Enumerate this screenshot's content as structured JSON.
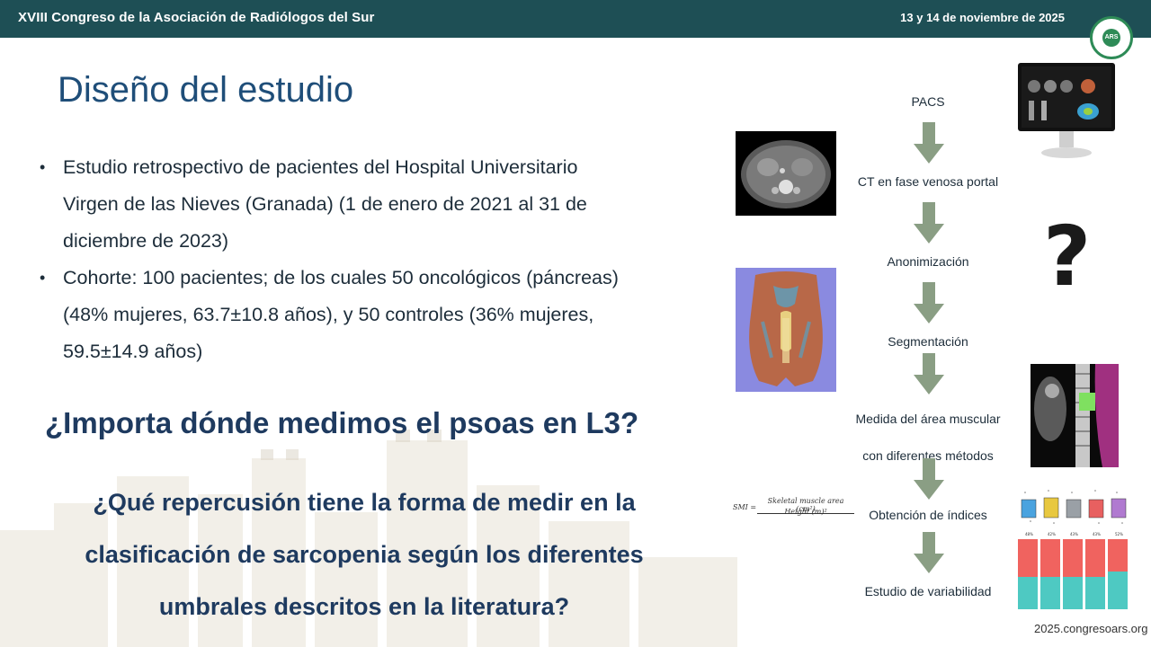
{
  "header": {
    "congress": "XVIII Congreso de la Asociación de Radiólogos del Sur",
    "dates": "13 y 14 de noviembre de 2025",
    "logo_text": "ARS"
  },
  "title": "Diseño del estudio",
  "bullets": [
    {
      "marker": "•",
      "lines": [
        "Estudio retrospectivo de pacientes del Hospital Universitario",
        "Virgen de las Nieves (Granada) (1 de enero de 2021 al 31 de",
        "diciembre de 2023)"
      ]
    },
    {
      "marker": "•",
      "lines": [
        "Cohorte: 100 pacientes; de los cuales 50 oncológicos (páncreas)",
        "(48% mujeres, 63.7±10.8 años), y 50 controles (36% mujeres,",
        "59.5±14.9 años)"
      ]
    }
  ],
  "question_1": "¿Importa dónde medimos el psoas en L3?",
  "question_2": [
    "¿Qué repercusión tiene la forma de medir en la",
    "clasificación de sarcopenia según los diferentes",
    "umbrales descritos en la literatura?"
  ],
  "flow": {
    "steps": [
      {
        "label": "PACS"
      },
      {
        "label": "CT en fase venosa portal"
      },
      {
        "label": "Anonimización"
      },
      {
        "label": "Segmentación"
      },
      {
        "label_lines": [
          "Medida del área muscular",
          "con diferentes métodos"
        ]
      },
      {
        "label": "Obtención de índices"
      },
      {
        "label": "Estudio de variabilidad"
      }
    ],
    "arrow_color": "#8a9e84"
  },
  "formula": {
    "lhs": "SMI =",
    "numerator": "Skeletal muscle area (cm²)",
    "denominator": "Height (m)²"
  },
  "chart_percent_labels": [
    "48%",
    "42%",
    "43%",
    "43%",
    "52%"
  ],
  "question_mark": "?",
  "footer_url": "2025.congresoars.org",
  "colors": {
    "header_bg": "#1e4f55",
    "title": "#1f4e79",
    "question_text": "#1e3a5f",
    "bar_red": "#f0635f",
    "bar_teal": "#4ec9c2"
  }
}
